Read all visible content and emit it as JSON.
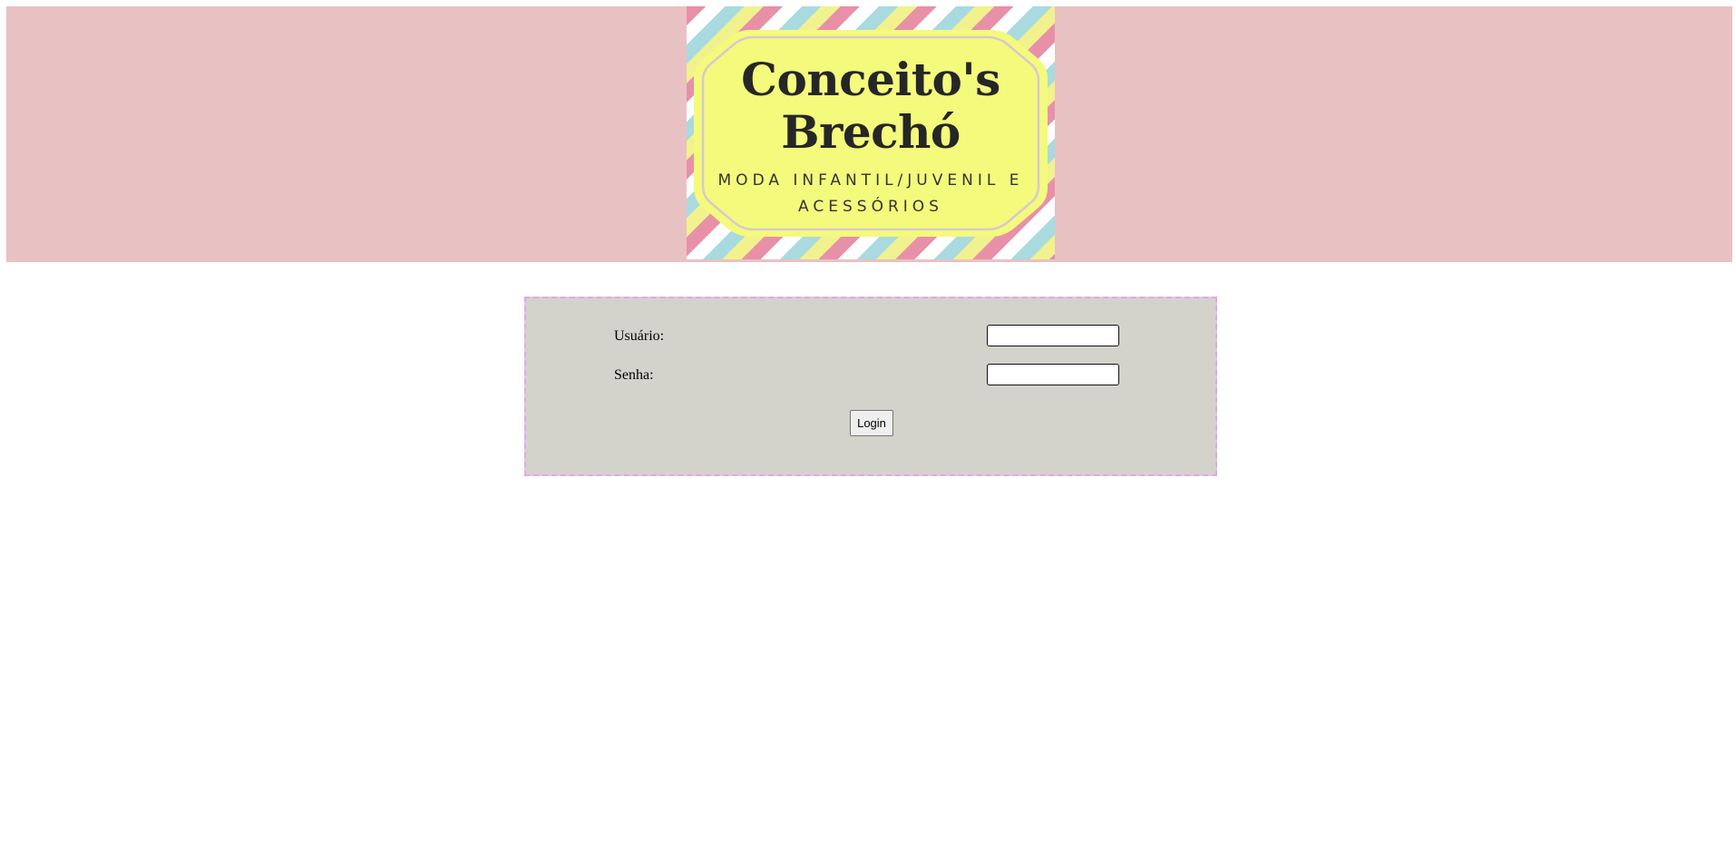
{
  "header": {
    "logo": {
      "title": "Conceito's\nBrechó",
      "subtitle": "MODA INFANTIL/JUVENIL E\nACESSÓRIOS",
      "colors": {
        "badge": "#f4fa7c",
        "stripe_pink": "#e890a8",
        "stripe_teal": "#a9dadf",
        "stripe_yellow": "#f1f28e"
      }
    },
    "background": "#e8c2c3"
  },
  "login": {
    "username_label": "Usuário:",
    "username_value": "",
    "password_label": "Senha:",
    "password_value": "",
    "submit_label": "Login",
    "box_background": "#d4d3cb",
    "box_border": "#e0a6f2"
  }
}
